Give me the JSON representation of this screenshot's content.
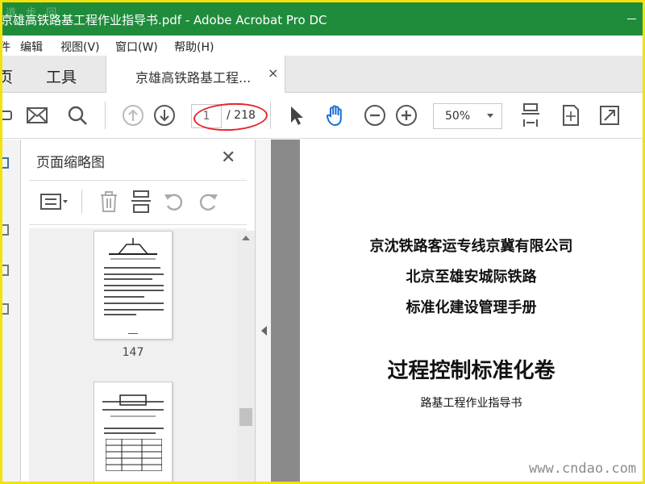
{
  "window": {
    "title": "京雄高铁路基工程作业指导书.pdf - Adobe Acrobat Pro DC",
    "watermark": "道 步 回"
  },
  "menu": {
    "items": [
      "件",
      "编辑",
      "视图(V)",
      "窗口(W)",
      "帮助(H)"
    ]
  },
  "tabs": {
    "home": "页",
    "tools": "工具",
    "document": "京雄高铁路基工程...",
    "close_glyph": "×"
  },
  "toolbar": {
    "current_page": "1",
    "total_pages": "/ 218",
    "zoom": "50%",
    "accent_color": "#1a6fd1"
  },
  "thumbnails": {
    "panel_title": "页面缩略图",
    "close_glyph": "✕",
    "pages": [
      "147"
    ]
  },
  "document": {
    "lines": [
      "京沈铁路客运专线京冀有限公司",
      "北京至雄安城际铁路",
      "标准化建设管理手册",
      "过程控制标准化卷",
      "路基工程作业指导书"
    ]
  },
  "watermark_site": "www.cndao.com"
}
